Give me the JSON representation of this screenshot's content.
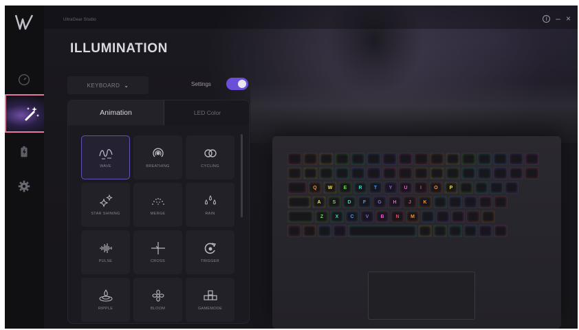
{
  "app": {
    "name": "UltraGear Studio"
  },
  "window": {
    "info_icon": "info-icon",
    "minimize": "–",
    "close": "×"
  },
  "sidebar": {
    "items": [
      {
        "name": "dashboard",
        "icon": "speedometer-icon",
        "active": false
      },
      {
        "name": "illumination",
        "icon": "magic-wand-icon",
        "active": true
      },
      {
        "name": "battery",
        "icon": "battery-icon",
        "active": false
      },
      {
        "name": "settings",
        "icon": "gear-icon",
        "active": false
      }
    ]
  },
  "page": {
    "title": "ILLUMINATION"
  },
  "controls": {
    "device_select": "KEYBOARD",
    "settings_label": "Settings",
    "settings_on": true
  },
  "panel": {
    "tabs": [
      {
        "label": "Animation",
        "active": true
      },
      {
        "label": "LED Color",
        "active": false
      }
    ],
    "effects": [
      {
        "label": "WAVE",
        "icon": "wave-icon",
        "selected": true
      },
      {
        "label": "BREATHING",
        "icon": "breathing-icon",
        "selected": false
      },
      {
        "label": "CYCLING",
        "icon": "cycling-icon",
        "selected": false
      },
      {
        "label": "STAR SHINING",
        "icon": "star-shining-icon",
        "selected": false
      },
      {
        "label": "MERGE",
        "icon": "merge-icon",
        "selected": false
      },
      {
        "label": "RAIN",
        "icon": "rain-icon",
        "selected": false
      },
      {
        "label": "PULSE",
        "icon": "pulse-icon",
        "selected": false
      },
      {
        "label": "CROSS",
        "icon": "cross-icon",
        "selected": false
      },
      {
        "label": "TRIGGER",
        "icon": "trigger-icon",
        "selected": false
      },
      {
        "label": "RIPPLE",
        "icon": "ripple-icon",
        "selected": false
      },
      {
        "label": "BLOOM",
        "icon": "bloom-icon",
        "selected": false
      },
      {
        "label": "GAMEMODE",
        "icon": "gamemode-icon",
        "selected": false
      }
    ]
  },
  "keyboard": {
    "row3": [
      "Q",
      "W",
      "E",
      "R",
      "T",
      "Y",
      "U",
      "I",
      "O",
      "P"
    ],
    "row4": [
      "A",
      "S",
      "D",
      "F",
      "G",
      "H",
      "J",
      "K"
    ],
    "row5": [
      "Z",
      "X",
      "C",
      "V",
      "B",
      "N",
      "M"
    ],
    "colors": [
      "#e84a5f",
      "#f2913d",
      "#f5e04a",
      "#6fdc4f",
      "#3fd6c0",
      "#4a9af2",
      "#8f5cf0",
      "#e45ad0"
    ]
  }
}
